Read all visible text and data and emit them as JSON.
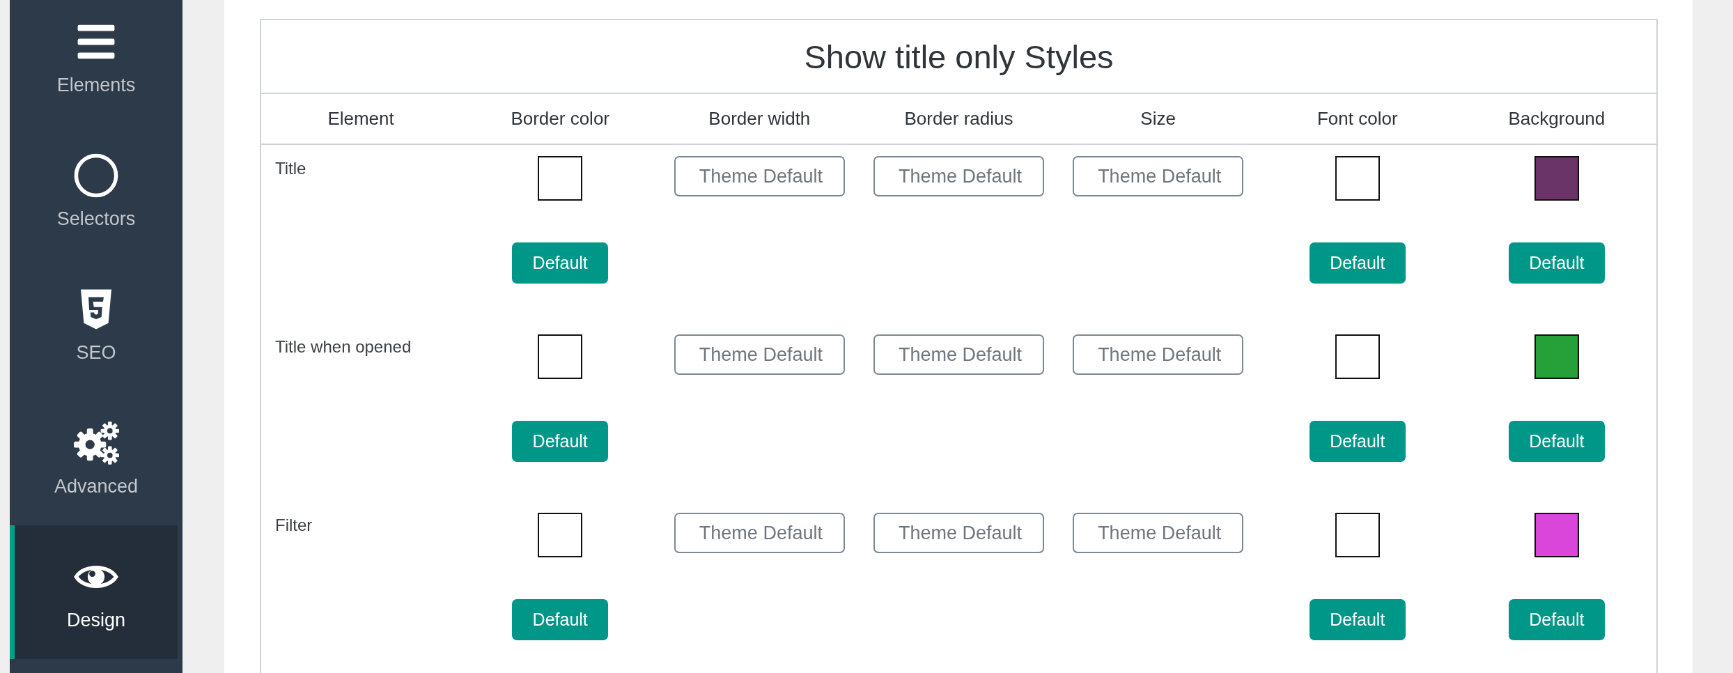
{
  "sidebar": {
    "items": [
      {
        "label": "Elements",
        "selected": false
      },
      {
        "label": "Selectors",
        "selected": false
      },
      {
        "label": "SEO",
        "selected": false
      },
      {
        "label": "Advanced",
        "selected": false
      },
      {
        "label": "Design",
        "selected": true
      }
    ]
  },
  "table": {
    "title": "Show title only Styles",
    "columns": [
      "Element",
      "Border color",
      "Border width",
      "Border radius",
      "Size",
      "Font color",
      "Background"
    ],
    "rows": [
      {
        "cells": [
          {
            "kind": "label",
            "text": "Title"
          },
          {
            "kind": "color",
            "color": "#ffffff",
            "button": "Default"
          },
          {
            "kind": "input",
            "placeholder": "Theme Default"
          },
          {
            "kind": "input",
            "placeholder": "Theme Default"
          },
          {
            "kind": "input",
            "placeholder": "Theme Default"
          },
          {
            "kind": "color",
            "color": "#ffffff",
            "button": "Default"
          },
          {
            "kind": "color",
            "color": "#6a3468",
            "button": "Default"
          }
        ]
      },
      {
        "cells": [
          {
            "kind": "label",
            "text": "Title when opened"
          },
          {
            "kind": "color",
            "color": "#ffffff",
            "button": "Default"
          },
          {
            "kind": "input",
            "placeholder": "Theme Default"
          },
          {
            "kind": "input",
            "placeholder": "Theme Default"
          },
          {
            "kind": "input",
            "placeholder": "Theme Default"
          },
          {
            "kind": "color",
            "color": "#ffffff",
            "button": "Default"
          },
          {
            "kind": "color",
            "color": "#26a13a",
            "button": "Default"
          }
        ]
      },
      {
        "cells": [
          {
            "kind": "label",
            "text": "Filter"
          },
          {
            "kind": "color",
            "color": "#ffffff",
            "button": "Default"
          },
          {
            "kind": "input",
            "placeholder": "Theme Default"
          },
          {
            "kind": "input",
            "placeholder": "Theme Default"
          },
          {
            "kind": "input",
            "placeholder": "Theme Default"
          },
          {
            "kind": "color",
            "color": "#ffffff",
            "button": "Default"
          },
          {
            "kind": "color",
            "color": "#d946d9",
            "button": "Default"
          }
        ]
      }
    ]
  }
}
